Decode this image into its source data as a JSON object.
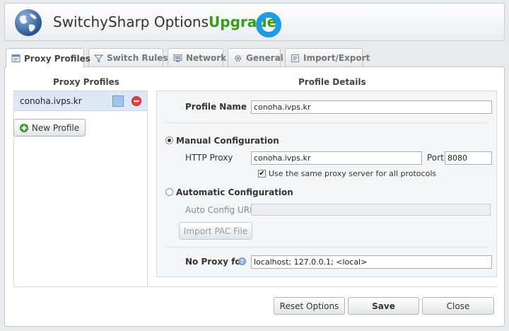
{
  "header": {
    "title": "SwitchySharp Options",
    "upgrade_label": "Upgrade"
  },
  "tabs": [
    {
      "label": "Proxy Profiles",
      "icon": "proxy-profiles-icon",
      "active": true
    },
    {
      "label": "Switch Rules",
      "icon": "funnel-icon",
      "active": false
    },
    {
      "label": "Network",
      "icon": "network-icon",
      "active": false
    },
    {
      "label": "General",
      "icon": "gear-icon",
      "active": false
    },
    {
      "label": "Import/Export",
      "icon": "import-export-icon",
      "active": false
    }
  ],
  "profiles": {
    "title": "Proxy Profiles",
    "items": [
      {
        "name": "conoha.ivps.kr",
        "color": "#9cc7ea"
      }
    ],
    "new_profile_label": "New Profile"
  },
  "details": {
    "title": "Profile Details",
    "profile_name_label": "Profile Name",
    "profile_name_value": "conoha.ivps.kr",
    "manual": {
      "label": "Manual Configuration",
      "selected": true,
      "http_proxy_label": "HTTP Proxy",
      "http_proxy_value": "conoha.ivps.kr",
      "port_label": "Port",
      "port_value": "8080",
      "same_proxy_label": "Use the same proxy server for all protocols",
      "same_proxy_checked": true
    },
    "automatic": {
      "label": "Automatic Configuration",
      "selected": false,
      "auto_config_url_label": "Auto Config URL",
      "auto_config_url_value": "",
      "import_pac_label": "Import PAC File"
    },
    "no_proxy_label": "No Proxy for",
    "no_proxy_value": "localhost; 127.0.0.1; <local>"
  },
  "footer": {
    "reset_label": "Reset Options",
    "save_label": "Save",
    "close_label": "Close"
  },
  "colors": {
    "accent_green": "#3a9a1c",
    "ring_blue": "#1e9be6",
    "selected_row": "#dfe7f4"
  }
}
